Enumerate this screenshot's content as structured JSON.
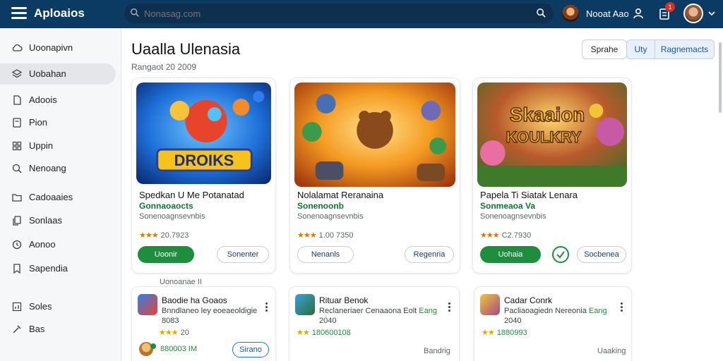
{
  "app": {
    "title": "Aploaios"
  },
  "search": {
    "placeholder": "Nonasag.com"
  },
  "topbar": {
    "user_name": "Nooat Aao",
    "notif_count": "1"
  },
  "sidebar": {
    "items": [
      {
        "label": "Uoonapivn",
        "icon": "cloud-icon"
      },
      {
        "label": "Uobahan",
        "icon": "layers-icon"
      },
      {
        "label": "Adoois",
        "icon": "document-icon"
      },
      {
        "label": "Pion",
        "icon": "file-icon"
      },
      {
        "label": "Uppin",
        "icon": "grid-icon"
      },
      {
        "label": "Nenoang",
        "icon": "search-icon"
      },
      {
        "label": "Cadoaaies",
        "icon": "folder-icon"
      },
      {
        "label": "Sonlaas",
        "icon": "copy-icon"
      },
      {
        "label": "Aonoo",
        "icon": "clock-icon"
      },
      {
        "label": "Sapendia",
        "icon": "bookmark-icon"
      },
      {
        "label": "Soles",
        "icon": "bar-chart-icon"
      },
      {
        "label": "Bas",
        "icon": "tools-icon"
      }
    ]
  },
  "main": {
    "title": "Uaalla Ulenasia",
    "subtitle": "Rangaot 20 2009",
    "segments": [
      "Sprahe",
      "Uty",
      "Ragnemacts"
    ],
    "section_label": "Uonoanae II",
    "featured": [
      {
        "title": "Spedkan U Me Potanatad",
        "genre": "Gonnaoaocts",
        "desc": "Sonenoagnsevnbis",
        "rating_stars": "★★★",
        "rating_text": "20.7923",
        "primary": "Uoonir",
        "secondary": "Sonenter",
        "banner_text": "DROIKS"
      },
      {
        "title": "Nolalamat Reranaina",
        "genre": "Sonenoonb",
        "desc": "Sonenoagnsevnbis",
        "rating_stars": "★★★",
        "rating_text": "1.00 7350",
        "primary": "Nenanls",
        "secondary": "Regenria",
        "banner_text": ""
      },
      {
        "title": "Papela Ti Siatak Lenara",
        "genre": "Sonmeaoa Va",
        "desc": "Sonenoagnsevnbis",
        "rating_stars": "★★★",
        "rating_text": "C2.7930",
        "primary": "Uohaia",
        "secondary": "Socbenea",
        "banner_text": "Skaaion KOULKRY"
      }
    ],
    "small": [
      {
        "title": "Baodie ha Goaos",
        "desc": "Bnndlaneo ley eoeaeoldigie",
        "desc_hl": "",
        "sub": "8083",
        "rating_stars": "★★★",
        "rating_text": "20",
        "rating_extra": "880003 IM",
        "button": "Sirano",
        "link": ""
      },
      {
        "title": "Rituar Benok",
        "desc": "Reclaneriaer Cenaaona Eolt",
        "desc_hl": "Eang",
        "sub": "2040",
        "rating_stars": "★★",
        "rating_text": "180600108",
        "rating_extra": "",
        "button": "",
        "link": "Bandrig"
      },
      {
        "title": "Cadar Conrk",
        "desc": "Pacliaoagiedn Nereonia",
        "desc_hl": "Eang",
        "sub": "2040",
        "rating_stars": "★★",
        "rating_text": "1880993",
        "rating_extra": "",
        "button": "",
        "link": "Uaaking"
      }
    ]
  }
}
